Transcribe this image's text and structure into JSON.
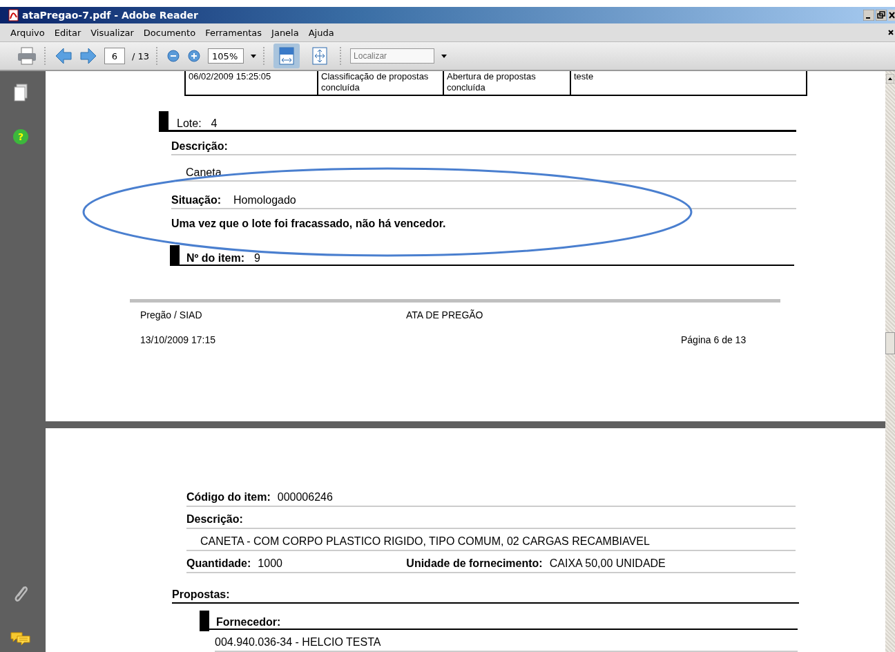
{
  "window": {
    "title": "ataPregao-7.pdf - Adobe Reader"
  },
  "menu": [
    "Arquivo",
    "Editar",
    "Visualizar",
    "Documento",
    "Ferramentas",
    "Janela",
    "Ajuda"
  ],
  "toolbar": {
    "page_number": "6",
    "page_total": "/ 13",
    "zoom": "105%",
    "search": {
      "placeholder": "Localizar"
    },
    "view_buttons": [
      {
        "kind": "fit-width",
        "selected": true
      },
      {
        "kind": "fit-page",
        "selected": false
      }
    ]
  },
  "sidebar": {
    "help_glyph": "?"
  },
  "page_1": {
    "table_row": [
      "06/02/2009 15:25:05",
      "Classificação de propostas concluída",
      "Abertura de propostas concluída",
      "teste"
    ],
    "lote": {
      "label": "Lote:",
      "value": "4"
    },
    "descricao": {
      "label": "Descrição:",
      "value": "Caneta"
    },
    "situacao": {
      "label": "Situação:",
      "value": "Homologado"
    },
    "note": "Uma vez que o lote foi fracassado, não há vencedor.",
    "item": {
      "label": "Nº do item:",
      "value": "9"
    },
    "footer": {
      "left": "Pregão / SIAD",
      "center": "ATA DE PREGÃO",
      "date": "13/10/2009 17:15",
      "page": "Página 6 de 13"
    }
  },
  "page_2": {
    "codigo": {
      "label": "Código do item:",
      "value": "000006246"
    },
    "descricao": {
      "label": "Descrição:",
      "value": "CANETA - COM CORPO PLASTICO RIGIDO, TIPO COMUM, 02 CARGAS  RECAMBIAVEL"
    },
    "quantidade": {
      "label": "Quantidade:",
      "value": "1000"
    },
    "unidade": {
      "label": "Unidade de fornecimento:",
      "value": "CAIXA 50,00 UNIDADE"
    },
    "propostas": "Propostas:",
    "fornecedor": {
      "label": "Fornecedor:",
      "value": "004.940.036-34 - HELCIO TESTA"
    }
  }
}
